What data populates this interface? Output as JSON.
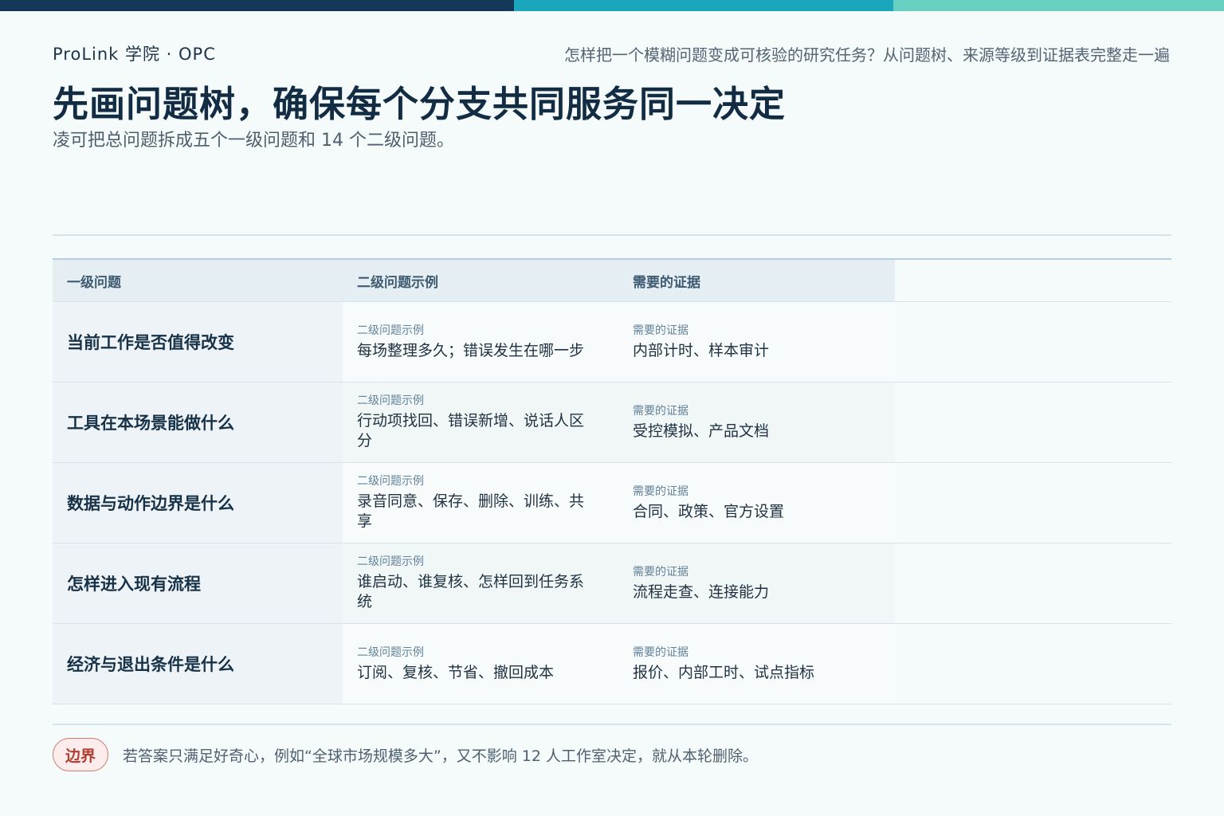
{
  "header": {
    "brand": "ProLink 学院 · OPC",
    "subject": "怎样把一个模糊问题变成可核验的研究任务？从问题树、来源等级到证据表完整走一遍"
  },
  "title": {
    "main": "先画问题树，确保每个分支共同服务同一决定",
    "subtitle": "凌可把总问题拆成五个一级问题和 14 个二级问题。"
  },
  "table": {
    "headers": [
      "一级问题",
      "二级问题示例",
      "需要的证据"
    ],
    "rows": [
      {
        "level1": "当前工作是否值得改变",
        "level2_label": "二级问题示例",
        "level2": "每场整理多久；错误发生在哪一步",
        "evidence_label": "需要的证据",
        "evidence": "内部计时、样本审计"
      },
      {
        "level1": "工具在本场景能做什么",
        "level2_label": "二级问题示例",
        "level2": "行动项找回、错误新增、说话人区分",
        "evidence_label": "需要的证据",
        "evidence": "受控模拟、产品文档"
      },
      {
        "level1": "数据与动作边界是什么",
        "level2_label": "二级问题示例",
        "level2": "录音同意、保存、删除、训练、共享",
        "evidence_label": "需要的证据",
        "evidence": "合同、政策、官方设置"
      },
      {
        "level1": "怎样进入现有流程",
        "level2_label": "二级问题示例",
        "level2": "谁启动、谁复核、怎样回到任务系统",
        "evidence_label": "需要的证据",
        "evidence": "流程走查、连接能力"
      },
      {
        "level1": "经济与退出条件是什么",
        "level2_label": "二级问题示例",
        "level2": "订阅、复核、节省、撤回成本",
        "evidence_label": "需要的证据",
        "evidence": "报价、内部工时、试点指标"
      }
    ]
  },
  "footer": {
    "badge": "边界",
    "note": "若答案只满足好奇心，例如“全球市场规模多大”，又不影响 12 人工作室决定，就从本轮删除。"
  },
  "colors": {
    "top_bar": [
      "#14385a",
      "#1aa6bd",
      "#67d0c0"
    ],
    "title": "#112c43",
    "badge_fill": "#fdecec",
    "badge_text": "#b13e33"
  }
}
